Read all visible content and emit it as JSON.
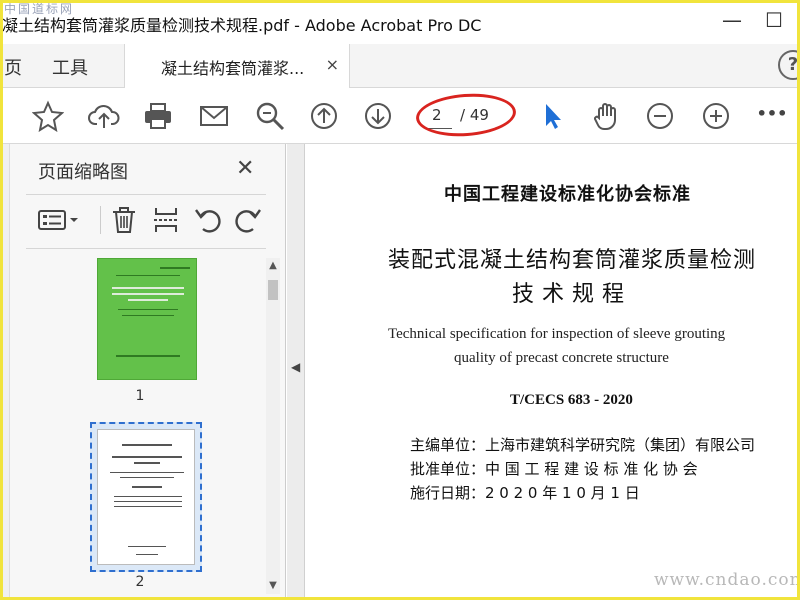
{
  "window": {
    "title": "凝土结构套筒灌浆质量检测技术规程.pdf - Adobe Acrobat Pro DC",
    "watermark": "中国道标网",
    "minimize": "—",
    "maximize": "☐"
  },
  "tabs": {
    "home_label": "页",
    "tools_label": "工具",
    "doc_tab_label": "凝土结构套筒灌浆...",
    "doc_tab_close": "×",
    "help_label": "?"
  },
  "toolbar": {
    "current_page": "2",
    "total_pages": "/ 49",
    "more": "•••"
  },
  "panel": {
    "title": "页面缩略图",
    "close": "✕",
    "thumbnails": [
      {
        "label": "1"
      },
      {
        "label": "2"
      }
    ]
  },
  "document": {
    "header": "中国工程建设标准化协会标准",
    "title_line1": "装配式混凝土结构套筒灌浆质量检测",
    "title_line2": "技术规程",
    "english_line1": "Technical specification for inspection of sleeve grouting",
    "english_line2": "quality of precast concrete structure",
    "code": "T/CECS 683 - 2020",
    "editor": "主编单位：上海市建筑科学研究院（集团）有限公司",
    "approver": "批准单位：中 国 工 程 建 设 标 准 化 协 会",
    "effective": "施行日期：2 0 2 0 年 1 0 月 1 日",
    "site_watermark": "www.cndao.com"
  },
  "colors": {
    "accent_blue": "#1f6fd6",
    "annotation_red": "#d9241f",
    "thumb_green": "#63c14a",
    "frame_yellow": "#f1e43c"
  },
  "icons": [
    "star-icon",
    "cloud-upload-icon",
    "printer-icon",
    "mail-icon",
    "zoom-search-icon",
    "page-up-icon",
    "page-down-icon",
    "select-arrow-icon",
    "hand-tool-icon",
    "zoom-out-icon",
    "zoom-in-icon",
    "more-icon",
    "options-list-icon",
    "trash-icon",
    "insert-page-icon",
    "rotate-ccw-icon",
    "rotate-cw-icon"
  ]
}
